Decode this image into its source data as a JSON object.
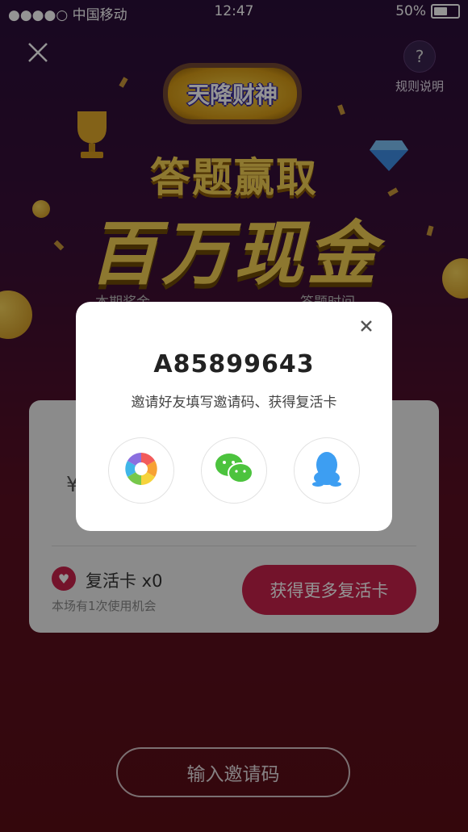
{
  "status_bar": {
    "carrier": "●●●●○ 中国移动",
    "time": "12:47",
    "battery": "50%"
  },
  "header": {
    "help_label": "规则说明",
    "help_symbol": "?"
  },
  "banner": {
    "badge_text": "天降财神",
    "title_line1": "答题赢取",
    "title_line2": "百万现金",
    "left_caption": "本期奖金",
    "right_caption": "答题时间"
  },
  "card": {
    "currency_symbol": "¥",
    "revive_label": "复活卡 x0",
    "revive_sub": "本场有1次使用机会",
    "get_more_button": "获得更多复活卡"
  },
  "modal": {
    "code": "A85899643",
    "hint": "邀请好友填写邀请码、获得复活卡",
    "share_targets": [
      "moments-icon",
      "wechat-icon",
      "qq-icon"
    ]
  },
  "footer": {
    "invite_button": "输入邀请码"
  },
  "colors": {
    "accent": "#c6214a",
    "gold": "#f3cf54",
    "bg_top": "#2a0f3a",
    "bg_bottom": "#5a0d16"
  }
}
